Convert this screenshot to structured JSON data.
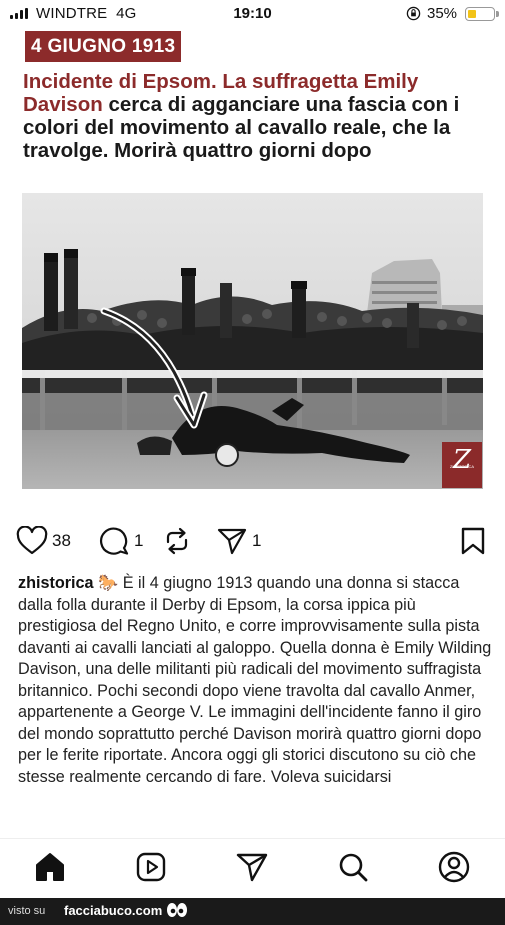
{
  "status": {
    "carrier": "WINDTRE",
    "network": "4G",
    "time": "19:10",
    "battery": "35%",
    "battery_level": 0.35,
    "signal_bars": 4
  },
  "post_image": {
    "date_badge": "4 GIUGNO 1913",
    "headline_red": "Incidente di Epsom. La suffragetta Emily Davison",
    "headline_rest": " cerca di agganciare una fascia con i colori del movimento al cavallo reale, che la travolge. Morirà quattro giorni dopo",
    "logo_letter": "Z",
    "logo_text": "ZHISTORICA"
  },
  "actions": {
    "likes": "38",
    "comments": "1",
    "shares": "1",
    "icons": [
      "heart-icon",
      "comment-icon",
      "repost-icon",
      "send-icon",
      "bookmark-icon"
    ]
  },
  "caption": {
    "username": "zhistorica",
    "emoji": "🐎",
    "text": "È il 4 giugno 1913 quando una donna si stacca dalla folla durante il Derby di Epsom, la corsa ippica più prestigiosa del Regno Unito, e corre improvvisamente sulla pista davanti ai cavalli lanciati al galoppo. Quella donna è Emily Wilding Davison, una delle militanti più radicali del movimento suffragista britannico. Pochi secondi dopo viene travolta dal cavallo Anmer, appartenente a George V. Le immagini dell'incidente fanno il giro del mondo soprattutto perché Davison morirà quattro giorni dopo per le ferite riportate. Ancora oggi gli storici discutono su ciò che stesse realmente cercando di fare. Voleva suicidarsi"
  },
  "nav": [
    "home-icon",
    "reels-icon",
    "send-icon",
    "search-icon",
    "profile-icon"
  ],
  "watermark": {
    "prefix": "visto su",
    "site": "facciabuco.com"
  },
  "colors": {
    "accent_red": "#8c2b2b",
    "battery_yellow": "#f2c318"
  }
}
